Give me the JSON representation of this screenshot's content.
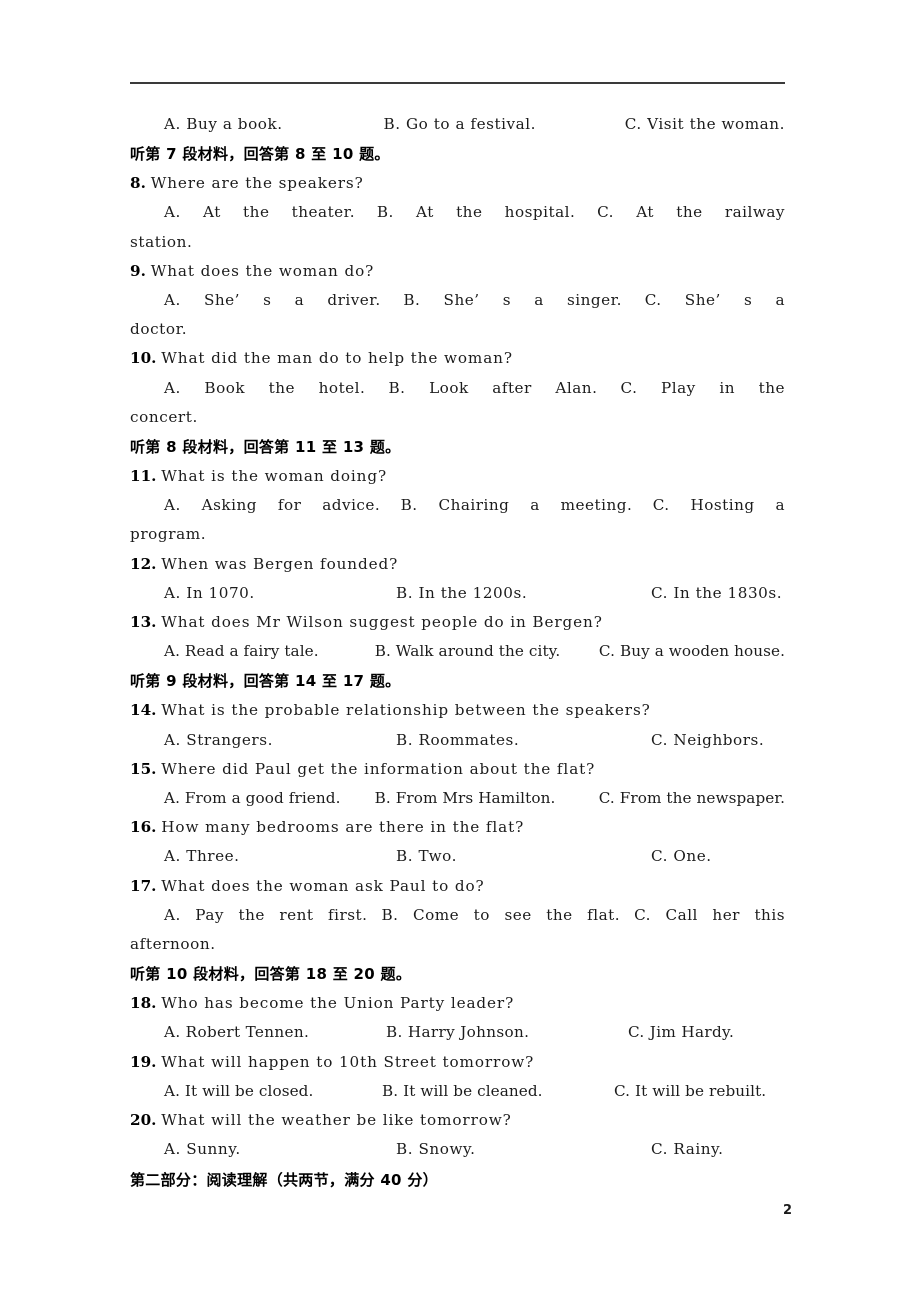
{
  "page": {
    "page_number": "2",
    "divider": true
  },
  "blocks": [
    {
      "kind": "options",
      "style": "normal",
      "name": "question-7-options",
      "a": "A. Buy a book.",
      "b": "B. Go to a festival.",
      "c": "C. Visit the woman."
    },
    {
      "kind": "cn-heading",
      "name": "listening-section-7-heading",
      "text": "听第 7 段材料，回答第 8 至 10 题。"
    },
    {
      "kind": "question",
      "name": "question-8",
      "number": "8.",
      "text": "Where are the speakers?"
    },
    {
      "kind": "options-justified",
      "name": "question-8-options",
      "a": "A. At the theater.",
      "b": "B. At the hospital.",
      "c": "C. At the railway"
    },
    {
      "kind": "continuation",
      "name": "question-8-options-wrap",
      "text": "station."
    },
    {
      "kind": "question",
      "name": "question-9",
      "number": "9.",
      "text": "What does the woman do?"
    },
    {
      "kind": "options-justified",
      "name": "question-9-options",
      "a": "A. She’ s a driver.",
      "b": "B. She’ s a singer.",
      "c": "C. She’ s a"
    },
    {
      "kind": "continuation",
      "name": "question-9-options-wrap",
      "text": "doctor."
    },
    {
      "kind": "question",
      "name": "question-10",
      "number": "10.",
      "text": "What did the man do to help the woman?"
    },
    {
      "kind": "options-justified",
      "name": "question-10-options",
      "a": "A. Book the hotel.",
      "b": "B. Look after Alan.",
      "c": "C. Play in the"
    },
    {
      "kind": "continuation",
      "name": "question-10-options-wrap",
      "text": "concert."
    },
    {
      "kind": "cn-heading",
      "name": "listening-section-8-heading",
      "text": "听第 8 段材料，回答第 11 至 13 题。"
    },
    {
      "kind": "question",
      "name": "question-11",
      "number": "11.",
      "text": "What is the woman doing?"
    },
    {
      "kind": "options-justified",
      "name": "question-11-options",
      "a": "A. Asking for advice.",
      "b": "B. Chairing a meeting.",
      "c": "C. Hosting a"
    },
    {
      "kind": "continuation",
      "name": "question-11-options-wrap",
      "text": "program."
    },
    {
      "kind": "question",
      "name": "question-12",
      "number": "12.",
      "text": "When was Bergen founded?"
    },
    {
      "kind": "options",
      "style": "normal",
      "name": "question-12-options",
      "a": "A. In 1070.",
      "b": "B. In the 1200s.",
      "c": "C. In the 1830s."
    },
    {
      "kind": "question",
      "name": "question-13",
      "number": "13.",
      "text": "What does Mr Wilson suggest people do in Bergen?"
    },
    {
      "kind": "options",
      "style": "tight",
      "name": "question-13-options",
      "a": "A. Read a fairy tale.",
      "b": "B. Walk around the city.",
      "c": "C. Buy a wooden house."
    },
    {
      "kind": "cn-heading",
      "name": "listening-section-9-heading",
      "text": "听第 9 段材料，回答第 14 至 17 题。"
    },
    {
      "kind": "question",
      "name": "question-14",
      "number": "14.",
      "text": "What is the probable relationship between the speakers?"
    },
    {
      "kind": "options",
      "style": "normal",
      "name": "question-14-options",
      "a": "A. Strangers.",
      "b": "B. Roommates.",
      "c": "C. Neighbors."
    },
    {
      "kind": "question",
      "name": "question-15",
      "number": "15.",
      "text": "Where did Paul get the information about the flat?"
    },
    {
      "kind": "options",
      "style": "tight",
      "name": "question-15-options",
      "a": "A. From a good friend.",
      "b": "B. From Mrs Hamilton.",
      "c": "C. From the newspaper."
    },
    {
      "kind": "question",
      "name": "question-16",
      "number": "16.",
      "text": "How many bedrooms are there in the flat?"
    },
    {
      "kind": "options",
      "style": "normal",
      "name": "question-16-options",
      "a": "A. Three.",
      "b": "B. Two.",
      "c": "C. One."
    },
    {
      "kind": "question",
      "name": "question-17",
      "number": "17.",
      "text": "What does the woman ask Paul to do?"
    },
    {
      "kind": "options-justified",
      "name": "question-17-options",
      "a": "A. Pay the rent first.",
      "b": "B. Come to see the flat.",
      "c": "C. Call her this"
    },
    {
      "kind": "continuation",
      "name": "question-17-options-wrap",
      "text": "afternoon."
    },
    {
      "kind": "cn-heading",
      "name": "listening-section-10-heading",
      "text": "听第 10 段材料，回答第 18 至 20 题。"
    },
    {
      "kind": "question",
      "name": "question-18",
      "number": "18.",
      "text": "Who has become the Union Party leader?"
    },
    {
      "kind": "options",
      "style": "wide",
      "name": "question-18-options",
      "a": "A. Robert Tennen.",
      "b": "B. Harry Johnson.",
      "c": "C. Jim Hardy."
    },
    {
      "kind": "question",
      "name": "question-19",
      "number": "19.",
      "text": "What will happen to 10th Street tomorrow?"
    },
    {
      "kind": "options",
      "style": "tight",
      "name": "question-19-options",
      "a": "A. It will be closed.",
      "b": "B. It will be cleaned.",
      "c": "C. It will be rebuilt."
    },
    {
      "kind": "question",
      "name": "question-20",
      "number": "20.",
      "text": "What will the weather be like tomorrow?"
    },
    {
      "kind": "options",
      "style": "normal",
      "name": "question-20-options",
      "a": "A. Sunny.",
      "b": "B. Snowy.",
      "c": "C. Rainy."
    },
    {
      "kind": "cn-heading",
      "name": "part-two-heading",
      "text": "第二部分：阅读理解（共两节，满分 40 分）"
    }
  ]
}
